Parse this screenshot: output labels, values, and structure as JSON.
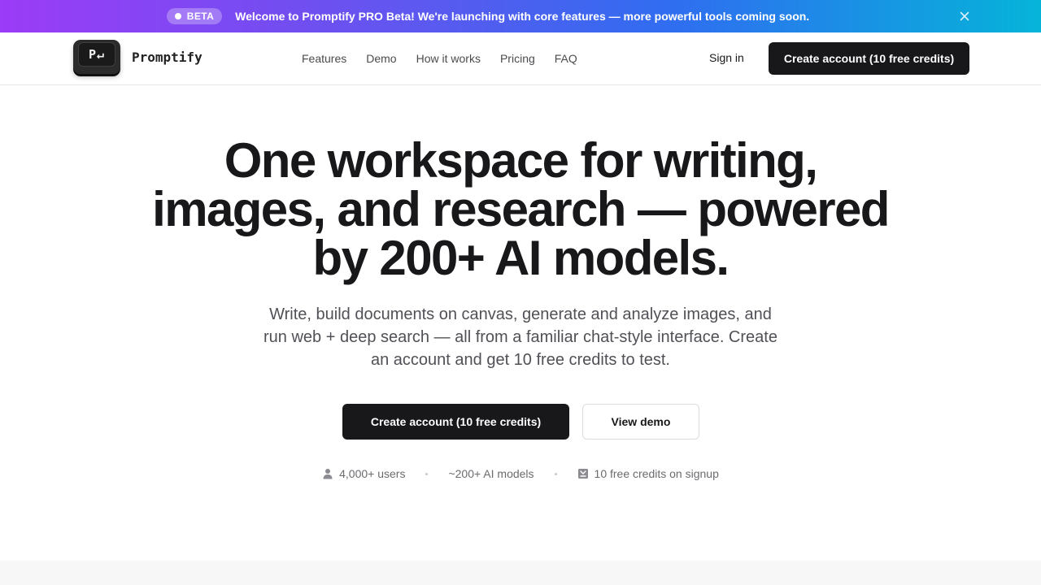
{
  "announcement": {
    "badge": "BETA",
    "text": "Welcome to Promptify PRO Beta! We're launching with core features — more powerful tools coming soon.",
    "close_icon": "close-icon"
  },
  "brand": {
    "logo_key_text": "P↵",
    "name": "Promptify"
  },
  "nav": {
    "items": [
      {
        "label": "Features"
      },
      {
        "label": "Demo"
      },
      {
        "label": "How it works"
      },
      {
        "label": "Pricing"
      },
      {
        "label": "FAQ"
      }
    ],
    "signin": "Sign in",
    "cta": "Create account (10 free credits)"
  },
  "hero": {
    "title_lines": [
      "One workspace for writing,",
      "images, and research — powered",
      "by 200+ AI models."
    ],
    "subtitle_lines": [
      "Write, build documents on canvas, generate and analyze images, and",
      "run web + deep search — all from a familiar chat-style interface. Create",
      "an account and get 10 free credits to test."
    ],
    "primary_cta": "Create account (10 free credits)",
    "secondary_cta": "View demo"
  },
  "stats": [
    {
      "icon": "user-icon",
      "label": "4,000+ users"
    },
    {
      "icon": "",
      "label": "~200+ AI models"
    },
    {
      "icon": "credit-icon",
      "label": "10 free credits on signup"
    }
  ],
  "colors": {
    "banner_gradient_start": "#9b3cf7",
    "banner_gradient_end": "#05b4d9",
    "primary_button": "#18181b"
  }
}
